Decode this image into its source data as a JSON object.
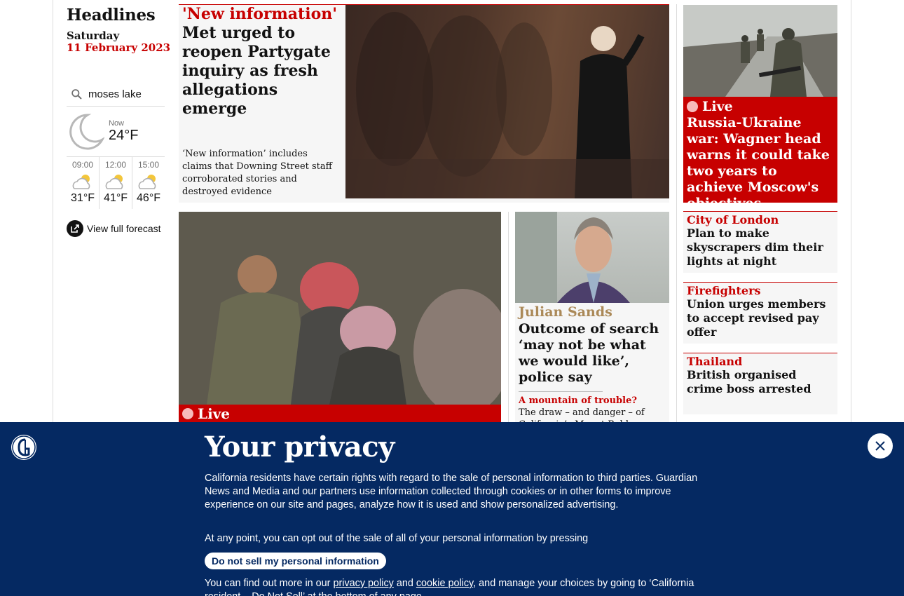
{
  "colors": {
    "news_red": "#c70000",
    "culture_gold": "#ab8958",
    "privacy_navy": "#052962",
    "card_grey": "#f6f6f6"
  },
  "headlines": {
    "title": "Headlines",
    "day": "Saturday",
    "date": "11 February 2023"
  },
  "weather": {
    "location": "moses lake",
    "now_label": "Now",
    "now_temp": "24°F",
    "now_icon": "crescent-moon-icon",
    "forecast": [
      {
        "time": "09:00",
        "temp": "31°F",
        "icon": "partly-cloudy-icon"
      },
      {
        "time": "12:00",
        "temp": "41°F",
        "icon": "partly-cloudy-icon"
      },
      {
        "time": "15:00",
        "temp": "46°F",
        "icon": "partly-cloudy-icon"
      }
    ],
    "full_forecast_link": "View full forecast"
  },
  "cards": {
    "partygate": {
      "kicker": "'New information'",
      "headline": "Met urged to reopen Partygate inquiry as fresh allegations emerge",
      "standfirst": "‘New information’ includes claims that Downing Street staff corroborated stories and destroyed evidence"
    },
    "earthquake": {
      "live_label": "Live"
    },
    "julian_sands": {
      "kicker": "Julian Sands",
      "headline": "Outcome of search ‘may not be what we would like’, police say",
      "sub_kicker": "A mountain of trouble?",
      "sub_text": "The draw – and danger – of California’s Mount Baldy"
    },
    "ukraine": {
      "live_label": "Live",
      "headline": "Russia-Ukraine war: Wagner head warns it could take two years to achieve Moscow's objectives"
    },
    "small": [
      {
        "kicker": "City of London",
        "headline": "Plan to make skyscrapers dim their lights at night"
      },
      {
        "kicker": "Firefighters",
        "headline": "Union urges members to accept revised pay offer"
      },
      {
        "kicker": "Thailand",
        "headline": "British organised crime boss arrested"
      }
    ]
  },
  "privacy": {
    "title": "Your privacy",
    "body": "California residents have certain rights with regard to the sale of personal information to third parties. Guardian News and Media and our partners use information collected through cookies or in other forms to improve experience on our site and pages, analyze how it is used and show personalized advertising.",
    "opt_out_text": "At any point, you can opt out of the sale of all of your personal information by pressing",
    "button_label": "Do not sell my personal information",
    "more_prefix": "You can find out more in our",
    "privacy_link": "privacy policy",
    "and_text": "and",
    "cookie_link": "cookie policy",
    "more_suffix": ", and manage your choices by going to ‘California resident – Do Not Sell’ at the bottom of any page."
  }
}
